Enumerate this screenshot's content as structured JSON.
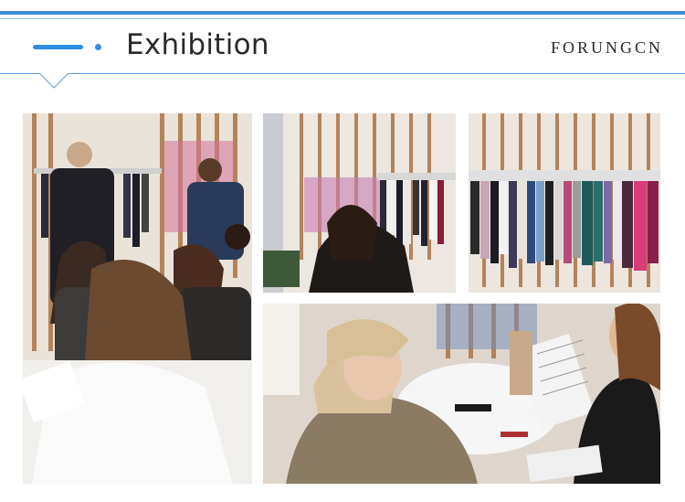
{
  "header": {
    "title": "Exhibition",
    "brand": "FORUNGCN",
    "accent_color": "#2f8fe0"
  },
  "gallery": {
    "photos": [
      {
        "subject": "visitors examining fabric samples at exhibition booth"
      },
      {
        "subject": "women reviewing fabric swatches in front of hanging fabric rack"
      },
      {
        "subject": "rack of colorful hanging fabric samples"
      },
      {
        "subject": "visitors at round table reviewing fabric swatch cards"
      }
    ]
  }
}
